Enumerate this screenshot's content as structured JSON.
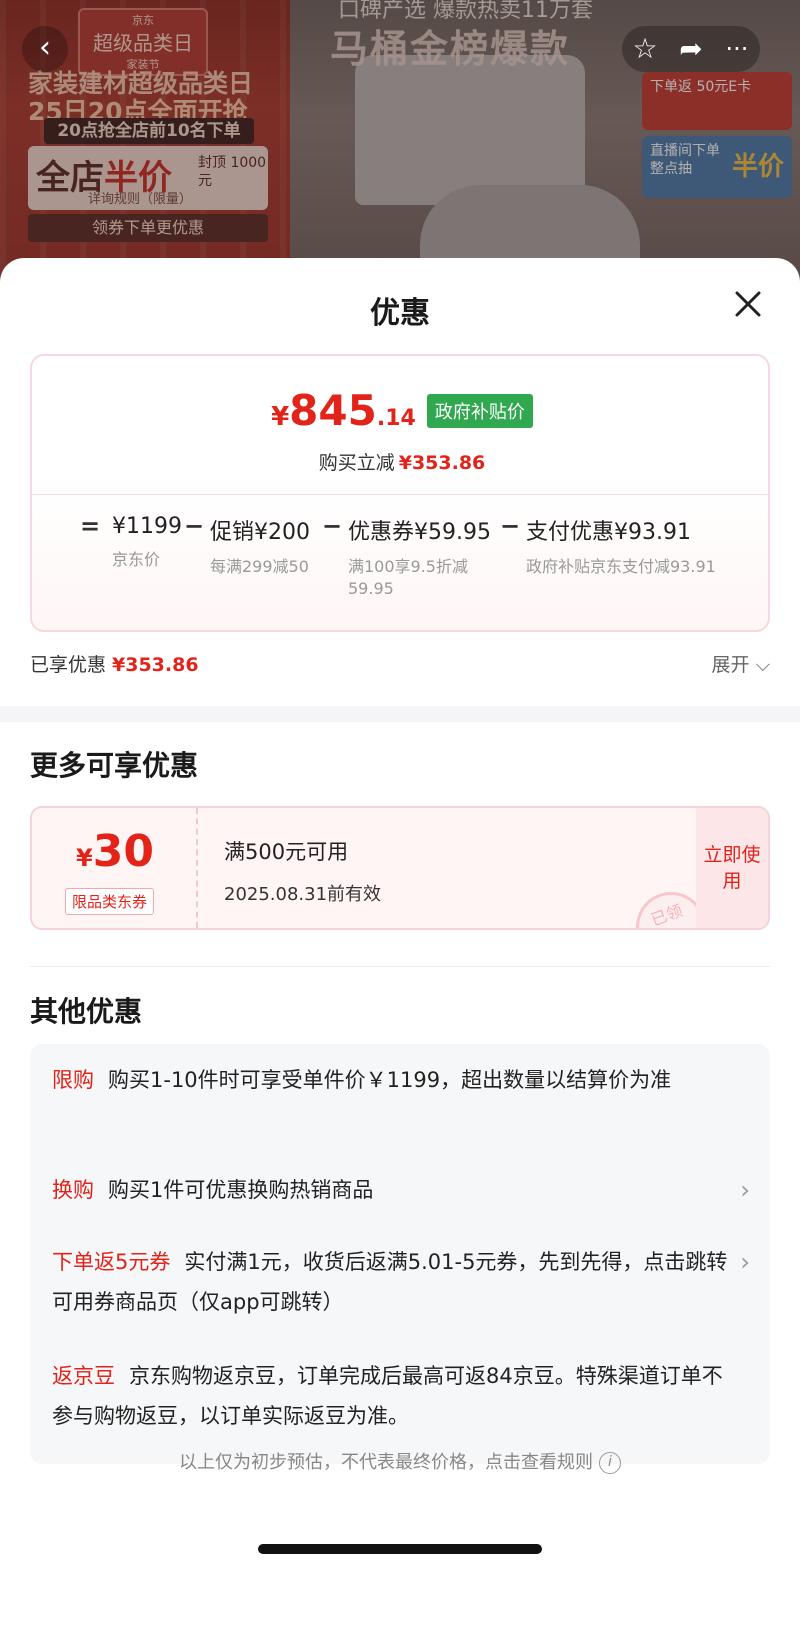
{
  "background": {
    "back_icon": "chevron-left-icon",
    "badge_title": "京东",
    "badge_main": "超级品类日",
    "badge_sub": "家装节",
    "line1": "家装建材超级品类日",
    "line2": "25日20点全面开抢",
    "line3": "20点抢全店前10名下单",
    "half_price_a": "全店",
    "half_price_b": "半价",
    "half_cap": "封顶 1000元",
    "rule": "详询规则（限量）",
    "coupon_btn": "领券下单更优惠",
    "top_text": "口碑产选 爆款热卖11万套",
    "title": "马桶金榜爆款",
    "promo1": "下单返 50元E卡",
    "promo2_a": "直播间下单",
    "promo2_b": "整点抽",
    "promo2_c": "半价"
  },
  "sheet": {
    "title": "优惠",
    "close_icon": "close-icon"
  },
  "price": {
    "yen": "¥",
    "final_int": "845",
    "final_dec": ".14",
    "gov_tag": "政府补贴价",
    "instant_label": "购买立减",
    "instant_value": "¥353.86",
    "breakdown": [
      {
        "op": "=",
        "value": "¥1199",
        "note": "京东价"
      },
      {
        "op": "−",
        "value": "促销¥200",
        "note": "每满299减50"
      },
      {
        "op": "−",
        "value": "优惠券¥59.95",
        "note": "满100享9.5折减59.95"
      },
      {
        "op": "−",
        "value": "支付优惠¥93.91",
        "note": "政府补贴京东支付减93.91"
      }
    ]
  },
  "enjoyed": {
    "label": "已享优惠",
    "value": "¥353.86",
    "expand": "展开 ⌵"
  },
  "more": {
    "title": "更多可享优惠",
    "coupon": {
      "yen": "¥",
      "amount": "30",
      "type": "限品类东券",
      "condition": "满500元可用",
      "expiry": "2025.08.31前有效",
      "use_label": "立即使用",
      "stamp": "已领"
    }
  },
  "other": {
    "title": "其他优惠",
    "items": [
      {
        "tag": "限购",
        "text": "购买1-10件时可享受单件价￥1199，超出数量以结算价为准",
        "has_arrow": false
      },
      {
        "tag": "换购",
        "text": "购买1件可优惠换购热销商品",
        "has_arrow": true
      },
      {
        "tag": "下单返5元券",
        "text": "实付满1元，收货后返满5.01-5元券，先到先得，点击跳转可用券商品页（仅app可跳转）",
        "has_arrow": true
      },
      {
        "tag": "返京豆",
        "text": "京东购物返京豆，订单完成后最高可返84京豆。特殊渠道订单不参与购物返豆，以订单实际返豆为准。",
        "has_arrow": false
      }
    ]
  },
  "footer": {
    "note": "以上仅为初步预估，不代表最终价格，点击查看规则",
    "info_icon": "info-icon"
  }
}
